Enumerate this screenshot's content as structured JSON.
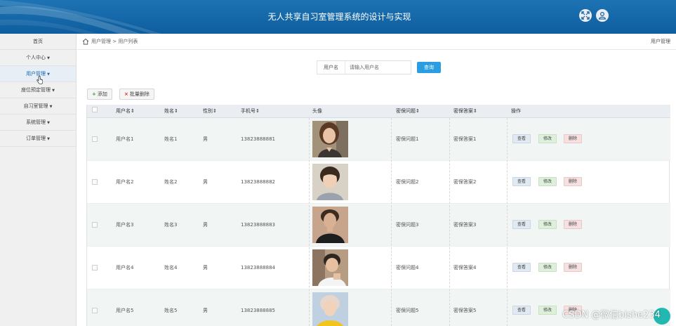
{
  "header": {
    "title": "无人共享自习室管理系统的设计与实现"
  },
  "sidebar": {
    "items": [
      {
        "label": "首页",
        "caret": ""
      },
      {
        "label": "个人中心",
        "caret": "▼"
      },
      {
        "label": "用户管理",
        "caret": "▼"
      },
      {
        "label": "座位预定管理",
        "caret": "▼"
      },
      {
        "label": "自习室管理",
        "caret": "▼"
      },
      {
        "label": "系统管理",
        "caret": "▼"
      },
      {
        "label": "订单管理",
        "caret": "▼"
      }
    ]
  },
  "breadcrumb": {
    "path": "用户管理 > 用户列表",
    "right": "用户管理"
  },
  "search": {
    "label": "用户名",
    "placeholder": "请输入用户名",
    "button": "查询"
  },
  "actions": {
    "add": "添加",
    "add_icon": "+",
    "batch_delete": "批量删除",
    "batch_icon": "×"
  },
  "table": {
    "headers": [
      "用户名⇕",
      "姓名⇕",
      "性别⇕",
      "手机号⇕",
      "头像",
      "密保问题⇕",
      "密保答案⇕",
      "操作"
    ],
    "rows": [
      {
        "username": "用户名1",
        "name": "姓名1",
        "gender": "男",
        "phone": "13823888881",
        "question": "密保问题1",
        "answer": "密保答案1"
      },
      {
        "username": "用户名2",
        "name": "姓名2",
        "gender": "男",
        "phone": "13823888882",
        "question": "密保问题2",
        "answer": "密保答案2"
      },
      {
        "username": "用户名3",
        "name": "姓名3",
        "gender": "男",
        "phone": "13823888883",
        "question": "密保问题3",
        "answer": "密保答案3"
      },
      {
        "username": "用户名4",
        "name": "姓名4",
        "gender": "男",
        "phone": "13823888884",
        "question": "密保问题4",
        "answer": "密保答案4"
      },
      {
        "username": "用户名5",
        "name": "姓名5",
        "gender": "男",
        "phone": "13823888885",
        "question": "密保问题5",
        "answer": "密保答案5"
      }
    ],
    "ops": {
      "view": "查看",
      "edit": "修改",
      "delete": "删除"
    }
  },
  "watermark": "CSDN @微信bishe234",
  "colors": {
    "header": "#1565a8",
    "accent": "#2a9ee0",
    "float_button": "#21b8b1"
  }
}
